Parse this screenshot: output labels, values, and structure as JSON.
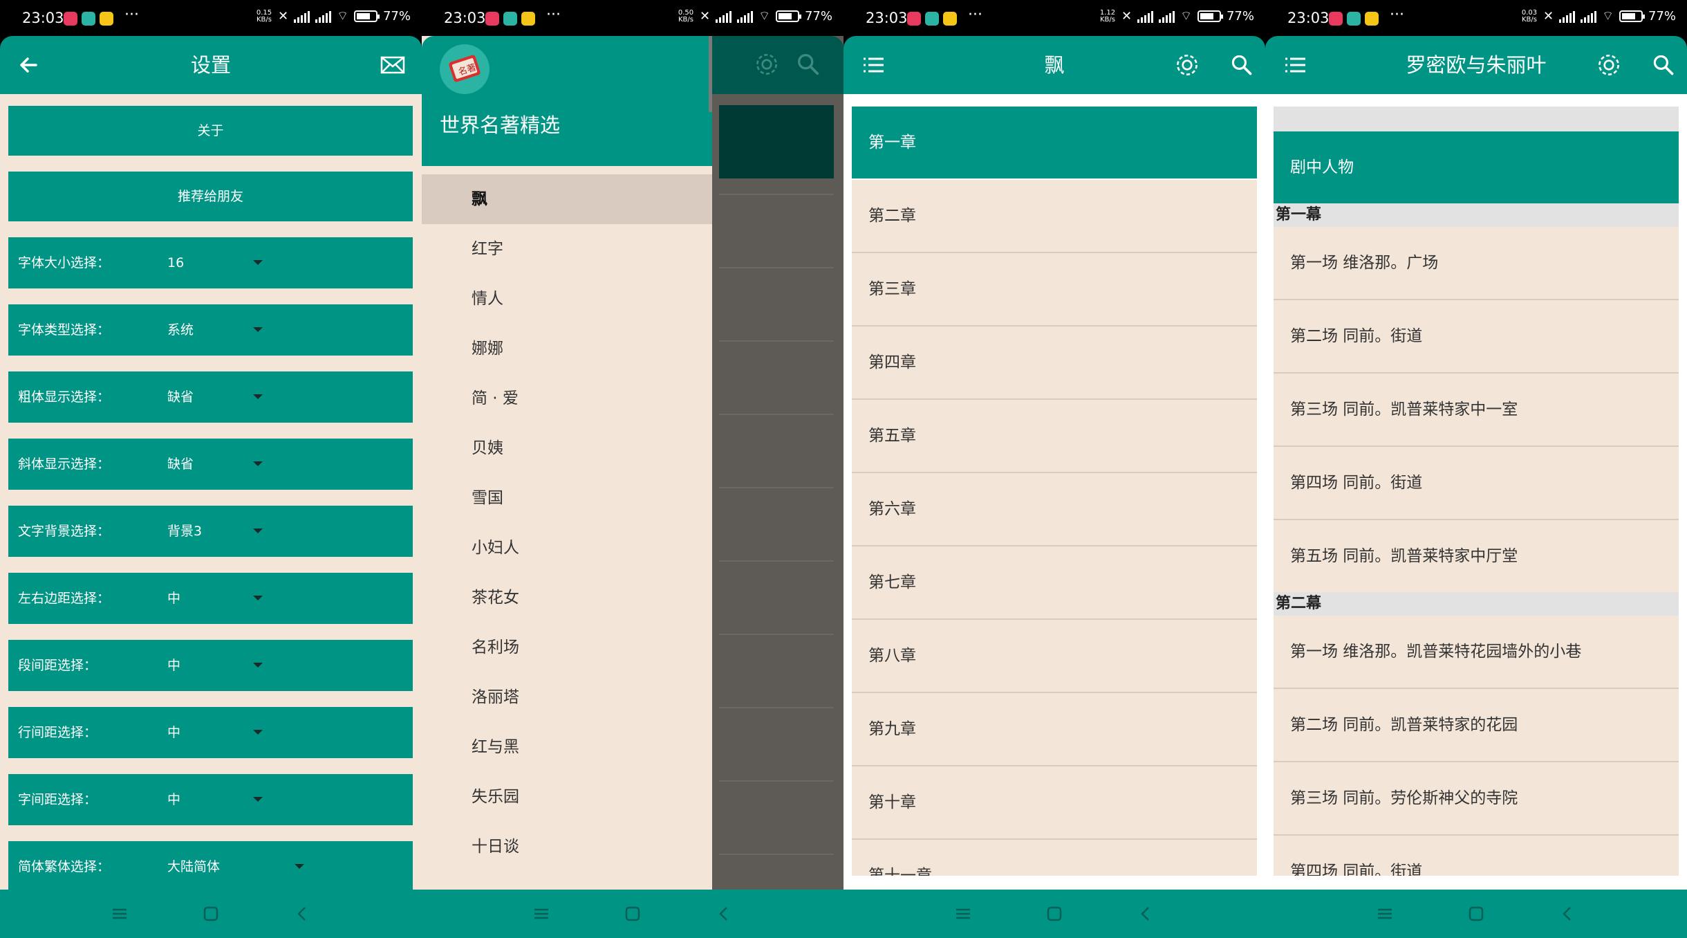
{
  "status": {
    "time": "23:03",
    "battery": "77%",
    "speeds": [
      "0.15 KB/s",
      "0.50 KB/s",
      "1.12 KB/s",
      "0.03 KB/s"
    ]
  },
  "colors": {
    "teal": "#009485",
    "cream": "#f3e6d8"
  },
  "settings_screen": {
    "title": "设置",
    "about": "关于",
    "recommend": "推荐给朋友",
    "rows": [
      {
        "label": "字体大小选择：",
        "value": "16"
      },
      {
        "label": "字体类型选择：",
        "value": "系统"
      },
      {
        "label": "粗体显示选择：",
        "value": "缺省"
      },
      {
        "label": "斜体显示选择：",
        "value": "缺省"
      },
      {
        "label": "文字背景选择：",
        "value": "背景3"
      },
      {
        "label": "左右边距选择：",
        "value": "中"
      },
      {
        "label": "段间距选择：",
        "value": "中"
      },
      {
        "label": "行间距选择：",
        "value": "中"
      },
      {
        "label": "字间距选择：",
        "value": "中"
      },
      {
        "label": "简体繁体选择：",
        "value": "大陆简体"
      }
    ]
  },
  "drawer_screen": {
    "app_title": "世界名著精选",
    "books": [
      "飘",
      "红字",
      "情人",
      "娜娜",
      "简 · 爱",
      "贝姨",
      "雪国",
      "小妇人",
      "茶花女",
      "名利场",
      "洛丽塔",
      "红与黑",
      "失乐园",
      "十日谈"
    ]
  },
  "chapters_screen": {
    "title": "飘",
    "chapters": [
      "第一章",
      "第二章",
      "第三章",
      "第四章",
      "第五章",
      "第六章",
      "第七章",
      "第八章",
      "第九章",
      "第十章",
      "第十一章"
    ]
  },
  "romeo_screen": {
    "title": "罗密欧与朱丽叶",
    "characters": "剧中人物",
    "act1": "第一幕",
    "act1_scenes": [
      "第一场 维洛那。广场",
      "第二场 同前。街道",
      "第三场 同前。凯普莱特家中一室",
      "第四场 同前。街道",
      "第五场 同前。凯普莱特家中厅堂"
    ],
    "act2": "第二幕",
    "act2_scenes": [
      "第一场 维洛那。凯普莱特花园墙外的小巷",
      "第二场 同前。凯普莱特家的花园",
      "第三场 同前。劳伦斯神父的寺院",
      "第四场 同前。街道"
    ]
  }
}
